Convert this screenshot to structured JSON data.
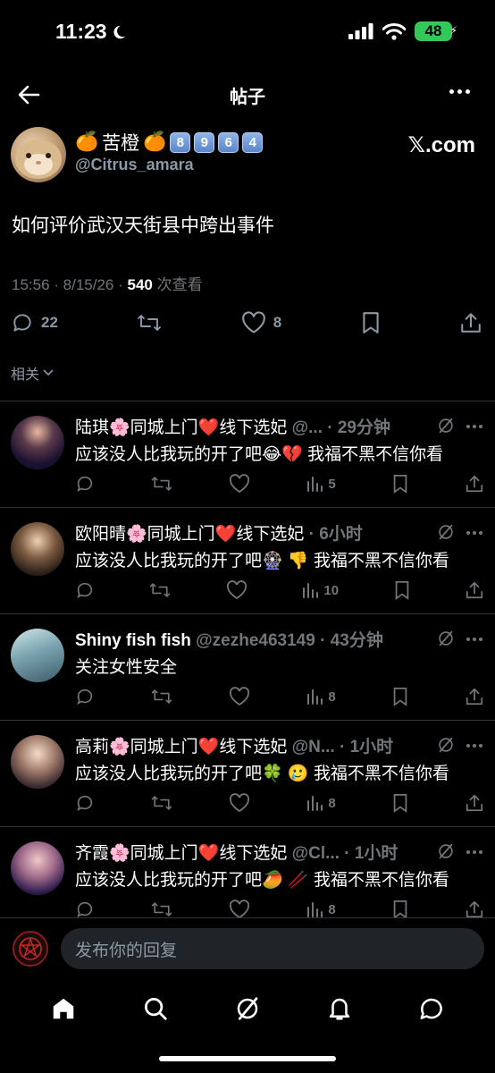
{
  "status_bar": {
    "time": "11:23",
    "battery": "48"
  },
  "header": {
    "title": "帖子"
  },
  "post": {
    "author_emoji_left": "🍊",
    "author_name": "苦橙",
    "author_emoji_right": "🍊",
    "author_digits": [
      "8",
      "9",
      "6",
      "4"
    ],
    "handle": "@Citrus_amara",
    "watermark": "𝕏.com",
    "text": "如何评价武汉天街县中跨出事件",
    "time": "15:56 · 8/15/26 · ",
    "views_count": "540",
    "views_label": " 次查看",
    "replies": "22",
    "likes": "8"
  },
  "related_label": "相关",
  "replies": [
    {
      "name": "陆琪🌸同城上门❤️线下选妃",
      "handle": " @...",
      "time": " · 29分钟",
      "text": "应该没人比我玩的开了吧😂💔 我福不黑不信你看",
      "views": "5",
      "bold": false
    },
    {
      "name": "欧阳晴🌸同城上门❤️线下选妃",
      "handle": "",
      "time": " · 6小时",
      "text": "应该没人比我玩的开了吧🎡 👎 我福不黑不信你看",
      "views": "10",
      "bold": false
    },
    {
      "name": "Shiny fish fish",
      "handle": " @zezhe463149",
      "time": " · 43分钟",
      "text": "关注女性安全",
      "views": "8",
      "bold": true
    },
    {
      "name": "高莉🌸同城上门❤️线下选妃",
      "handle": " @N...",
      "time": " · 1小时",
      "text": "应该没人比我玩的开了吧🍀 🥲 我福不黑不信你看",
      "views": "8",
      "bold": false
    },
    {
      "name": "齐霞🌸同城上门❤️线下选妃",
      "handle": " @Cl...",
      "time": " · 1小时",
      "text": "应该没人比我玩的开了吧🥭 🥢 我福不黑不信你看",
      "views": "8",
      "bold": false
    }
  ],
  "composer": {
    "placeholder": "发布你的回复"
  },
  "nav": {
    "icons": [
      "home-icon",
      "search-icon",
      "grok-icon",
      "notifications-icon",
      "messages-icon"
    ]
  }
}
